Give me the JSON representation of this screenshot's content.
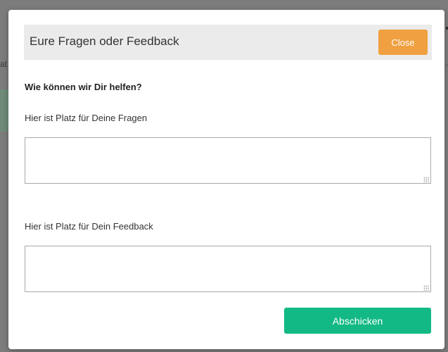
{
  "background": {
    "partial_text": "at"
  },
  "modal": {
    "title": "Eure Fragen oder Feedback",
    "close_label": "Close",
    "help_heading": "Wie können wir Dir helfen?",
    "questions": {
      "label": "Hier ist Platz für Deine Fragen",
      "value": ""
    },
    "feedback": {
      "label": "Hier ist Platz für Dein Feedback",
      "value": ""
    },
    "submit_label": "Abschicken"
  },
  "colors": {
    "close_button": "#f0a040",
    "submit_button": "#13b985",
    "header_background": "#ebebeb",
    "overlay": "#7c7c7c"
  }
}
